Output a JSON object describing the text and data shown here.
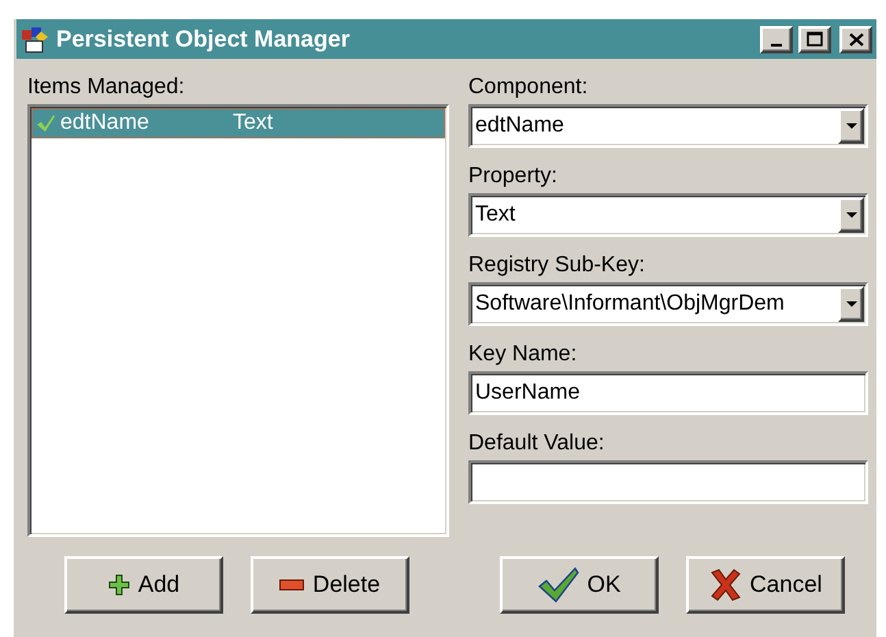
{
  "window": {
    "title": "Persistent Object Manager"
  },
  "items_managed": {
    "label": "Items Managed:",
    "rows": [
      {
        "checked": true,
        "component": "edtName",
        "property": "Text",
        "selected": true
      }
    ]
  },
  "fields": [
    {
      "kind": "combo",
      "label": "Component:",
      "value": "edtName"
    },
    {
      "kind": "combo",
      "label": "Property:",
      "value": "Text"
    },
    {
      "kind": "combo",
      "label": "Registry Sub-Key:",
      "value": "Software\\Informant\\ObjMgrDem"
    },
    {
      "kind": "text",
      "label": "Key Name:",
      "value": "UserName"
    },
    {
      "kind": "text",
      "label": "Default Value:"
    }
  ],
  "buttons": [
    {
      "kind": "add",
      "label": "Add"
    },
    {
      "kind": "delete",
      "label": "Delete"
    },
    {
      "kind": "ok",
      "label": "OK"
    },
    {
      "kind": "cancel",
      "label": "Cancel"
    }
  ]
}
